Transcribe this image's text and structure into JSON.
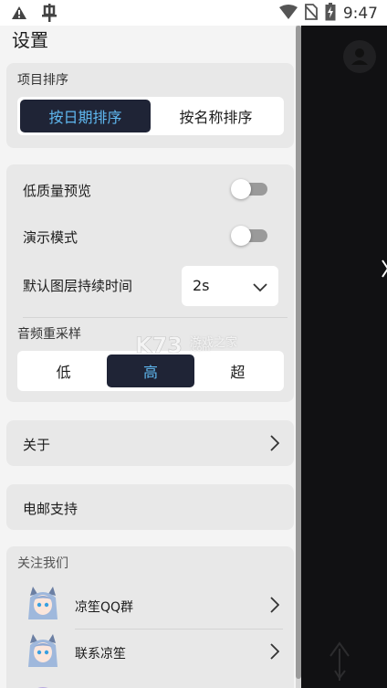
{
  "status_bar": {
    "left_icons": [
      "warning-icon",
      "bug-icon"
    ],
    "right_icons": [
      "wifi-icon",
      "no-sim-icon",
      "battery-charging-icon"
    ],
    "time": "9:47"
  },
  "drawer": {
    "title": "设置",
    "sort": {
      "label": "项目排序",
      "options": [
        "按日期排序",
        "按名称排序"
      ],
      "selected": "按日期排序"
    },
    "preview": {
      "low_quality_label": "低质量预览",
      "low_quality_on": false,
      "demo_mode_label": "演示模式",
      "demo_mode_on": false,
      "layer_duration_label": "默认图层持续时间",
      "layer_duration_value": "2s",
      "resample_label": "音频重采样",
      "resample_options": [
        "低",
        "高",
        "超"
      ],
      "resample_selected": "高"
    },
    "about_label": "关于",
    "email_support_label": "电邮支持",
    "follow": {
      "label": "关注我们",
      "items": [
        "凉笙QQ群",
        "联系凉笙"
      ]
    }
  },
  "watermark": {
    "logo": "K73",
    "text": "游戏之家",
    "sub": ".com"
  },
  "colors": {
    "accent_dark": "#1f2436",
    "accent_text": "#5fb8f0",
    "scrim": "#111113",
    "card": "#e8e8e8"
  }
}
